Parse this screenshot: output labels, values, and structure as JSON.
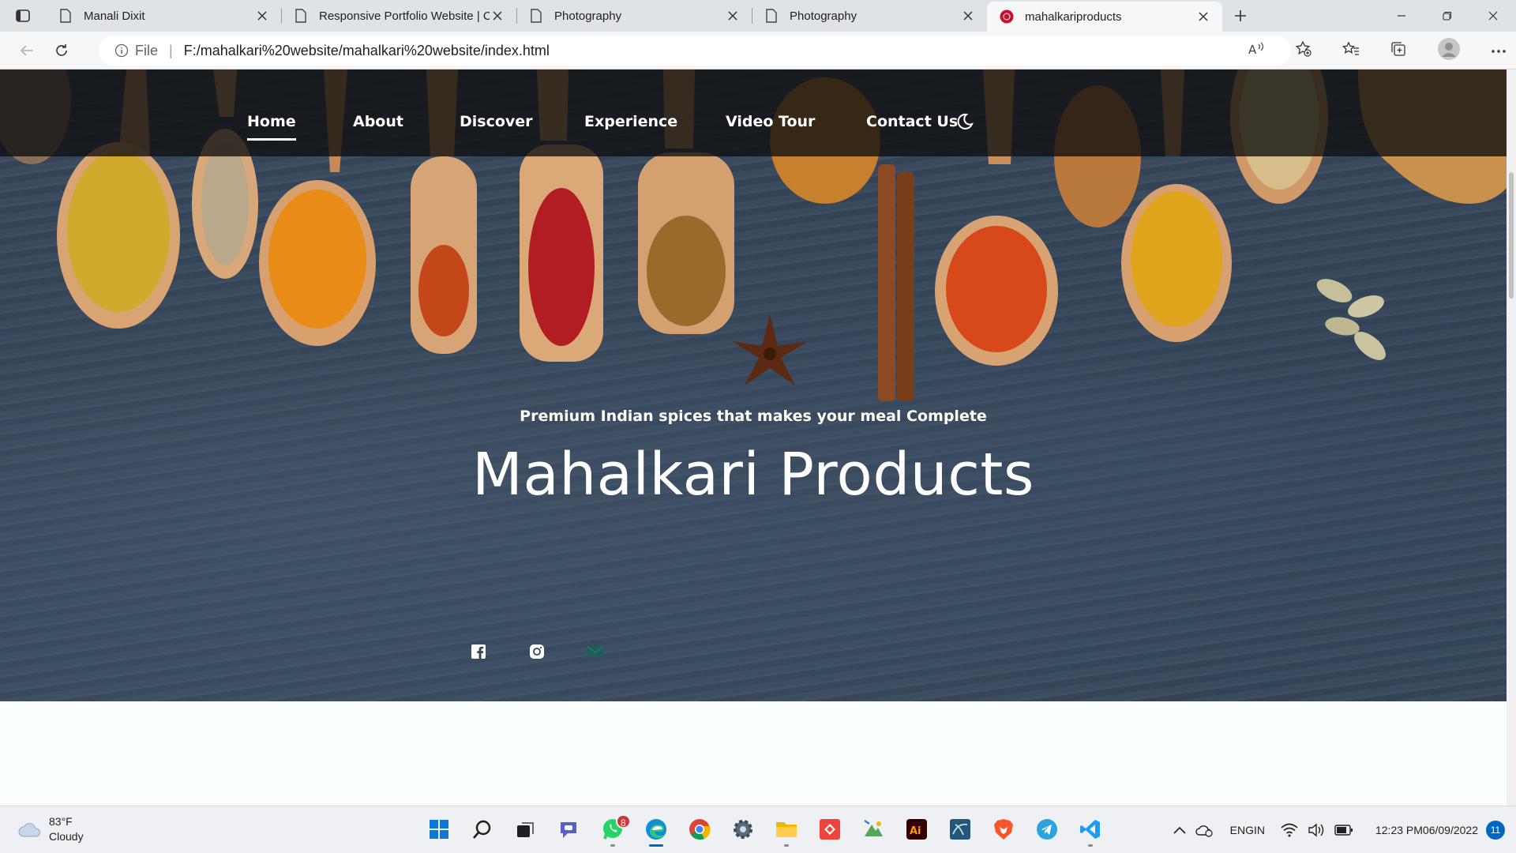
{
  "browser": {
    "tabs": [
      {
        "title": "Manali Dixit",
        "active": false
      },
      {
        "title": "Responsive Portfolio Website | C",
        "active": false
      },
      {
        "title": "Photography",
        "active": false
      },
      {
        "title": "Photography",
        "active": false
      },
      {
        "title": "mahalkariproducts",
        "active": true
      }
    ],
    "address": {
      "scheme_label": "File",
      "url": "F:/mahalkari%20website/mahalkari%20website/index.html"
    }
  },
  "page": {
    "nav": {
      "links": [
        "Home",
        "About",
        "Discover",
        "Experience",
        "Video Tour",
        "Contact Us"
      ],
      "active": "Home"
    },
    "hero": {
      "tagline": "Premium Indian spices that makes your meal Complete",
      "title": "Mahalkari Products"
    },
    "social_icons": [
      "facebook-icon",
      "instagram-icon",
      "email-icon"
    ],
    "colors": {
      "nav_bg": "#0e0e0e",
      "hero_stone": "#33455a",
      "nav_text": "#ffffff"
    }
  },
  "taskbar": {
    "weather": {
      "temp": "83°F",
      "condition": "Cloudy"
    },
    "apps": [
      "start",
      "search",
      "task-view",
      "teams-chat",
      "whatsapp",
      "edge",
      "chrome",
      "settings",
      "file-explorer",
      "anydesk",
      "photos",
      "illustrator",
      "mysql-workbench",
      "brave",
      "telegram",
      "vscode"
    ],
    "whatsapp_badge": "8",
    "language": {
      "line1": "ENG",
      "line2": "IN"
    },
    "clock": {
      "time": "12:23 PM",
      "date": "06/09/2022"
    },
    "notifications": "11"
  }
}
